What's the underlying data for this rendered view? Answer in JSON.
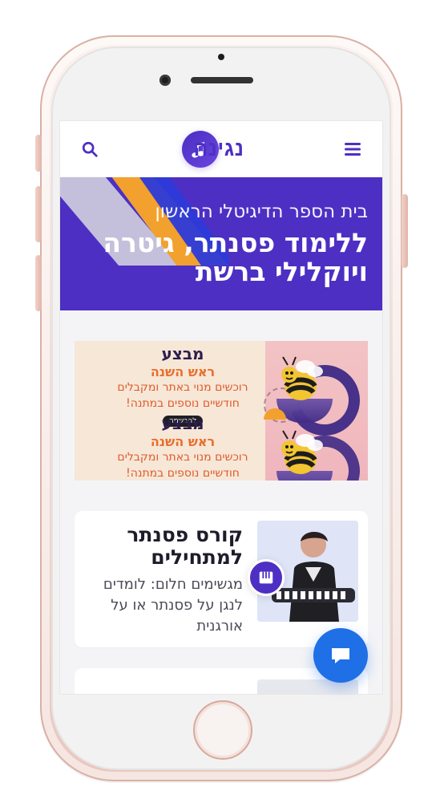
{
  "header": {
    "logo_text": "נגינה",
    "menu_icon": "hamburger-icon",
    "search_icon": "search-icon"
  },
  "hero": {
    "kicker": "בית הספר הדיגיטלי הראשון",
    "title_line1": "ללימוד פסנתר, גיטרה",
    "title_line2": "ויוקלילי ברשת"
  },
  "promo": {
    "block_top": {
      "title": "מבצע",
      "subtitle": "ראש השנה",
      "line1": "רוכשים מנוי באתר ומקבלים",
      "line2": "חודשיים נוספים במתנה!",
      "pill": "להרשמה"
    },
    "block_bottom": {
      "title": "מבצע",
      "subtitle": "ראש השנה",
      "line1": "רוכשים מנוי באתר ומקבלים",
      "line2": "חודשיים נוספים במתנה!"
    }
  },
  "course_card": {
    "title_line1": "קורס פסנתר",
    "title_line2": "למתחילים",
    "desc_line1": "מגשימים חלום: לומדים",
    "desc_line2": "לנגן על פסנתר או על",
    "desc_line3": "אורגנית",
    "badge_icon": "piano-icon"
  },
  "chat": {
    "icon": "chat-icon"
  },
  "colors": {
    "primary": "#4d2fc4",
    "chat_blue": "#1f6fe6",
    "promo_orange": "#e86f2c"
  }
}
